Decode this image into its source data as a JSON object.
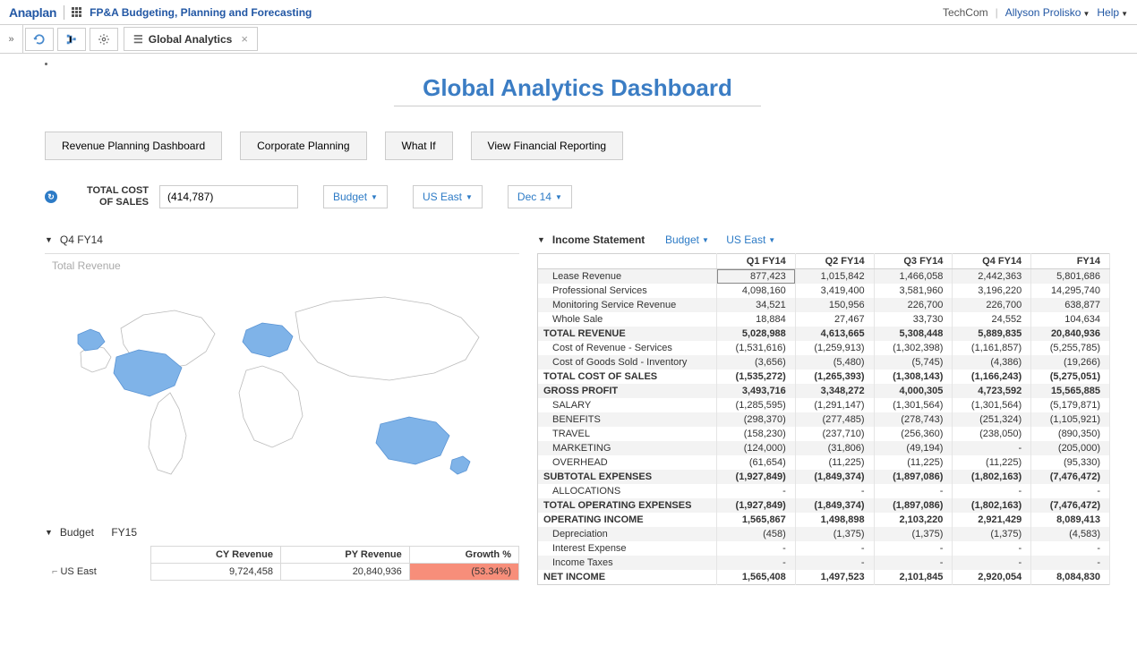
{
  "header": {
    "logo": "Anaplan",
    "breadcrumb": "FP&A Budgeting, Planning and Forecasting",
    "org": "TechCom",
    "user": "Allyson Prolisko",
    "help": "Help"
  },
  "tab": {
    "label": "Global Analytics"
  },
  "page_title": "Global Analytics Dashboard",
  "nav_buttons": [
    "Revenue Planning Dashboard",
    "Corporate Planning",
    "What If",
    "View Financial Reporting"
  ],
  "metric": {
    "label_line1": "TOTAL COST",
    "label_line2": "OF SALES",
    "value": "(414,787)"
  },
  "filters": {
    "version": "Budget",
    "region": "US East",
    "period": "Dec 14"
  },
  "map_panel": {
    "period": "Q4 FY14",
    "subtitle": "Total Revenue"
  },
  "budget_panel": {
    "label": "Budget",
    "year": "FY15",
    "columns": [
      "CY Revenue",
      "PY Revenue",
      "Growth %"
    ],
    "row": {
      "name": "US East",
      "cy": "9,724,458",
      "py": "20,840,936",
      "growth": "(53.34%)"
    }
  },
  "income_panel": {
    "title": "Income Statement",
    "version": "Budget",
    "region": "US East"
  },
  "income_table": {
    "columns": [
      "Q1 FY14",
      "Q2 FY14",
      "Q3 FY14",
      "Q4 FY14",
      "FY14"
    ],
    "rows": [
      {
        "label": "Lease Revenue",
        "values": [
          "877,423",
          "1,015,842",
          "1,466,058",
          "2,442,363",
          "5,801,686"
        ],
        "indent": true,
        "shade": true,
        "selected": 0
      },
      {
        "label": "Professional Services",
        "values": [
          "4,098,160",
          "3,419,400",
          "3,581,960",
          "3,196,220",
          "14,295,740"
        ],
        "indent": true
      },
      {
        "label": "Monitoring Service Revenue",
        "values": [
          "34,521",
          "150,956",
          "226,700",
          "226,700",
          "638,877"
        ],
        "indent": true,
        "shade": true
      },
      {
        "label": "Whole Sale",
        "values": [
          "18,884",
          "27,467",
          "33,730",
          "24,552",
          "104,634"
        ],
        "indent": true
      },
      {
        "label": "TOTAL REVENUE",
        "values": [
          "5,028,988",
          "4,613,665",
          "5,308,448",
          "5,889,835",
          "20,840,936"
        ],
        "bold": true,
        "shade": true
      },
      {
        "label": "Cost of Revenue - Services",
        "values": [
          "(1,531,616)",
          "(1,259,913)",
          "(1,302,398)",
          "(1,161,857)",
          "(5,255,785)"
        ],
        "indent": true
      },
      {
        "label": "Cost of Goods Sold - Inventory",
        "values": [
          "(3,656)",
          "(5,480)",
          "(5,745)",
          "(4,386)",
          "(19,266)"
        ],
        "indent": true,
        "shade": true
      },
      {
        "label": "TOTAL COST OF SALES",
        "values": [
          "(1,535,272)",
          "(1,265,393)",
          "(1,308,143)",
          "(1,166,243)",
          "(5,275,051)"
        ],
        "bold": true
      },
      {
        "label": "GROSS PROFIT",
        "values": [
          "3,493,716",
          "3,348,272",
          "4,000,305",
          "4,723,592",
          "15,565,885"
        ],
        "bold": true,
        "shade": true
      },
      {
        "label": "SALARY",
        "values": [
          "(1,285,595)",
          "(1,291,147)",
          "(1,301,564)",
          "(1,301,564)",
          "(5,179,871)"
        ],
        "indent": true
      },
      {
        "label": "BENEFITS",
        "values": [
          "(298,370)",
          "(277,485)",
          "(278,743)",
          "(251,324)",
          "(1,105,921)"
        ],
        "indent": true,
        "shade": true
      },
      {
        "label": "TRAVEL",
        "values": [
          "(158,230)",
          "(237,710)",
          "(256,360)",
          "(238,050)",
          "(890,350)"
        ],
        "indent": true
      },
      {
        "label": "MARKETING",
        "values": [
          "(124,000)",
          "(31,806)",
          "(49,194)",
          "-",
          "(205,000)"
        ],
        "indent": true,
        "shade": true
      },
      {
        "label": "OVERHEAD",
        "values": [
          "(61,654)",
          "(11,225)",
          "(11,225)",
          "(11,225)",
          "(95,330)"
        ],
        "indent": true
      },
      {
        "label": "SUBTOTAL EXPENSES",
        "values": [
          "(1,927,849)",
          "(1,849,374)",
          "(1,897,086)",
          "(1,802,163)",
          "(7,476,472)"
        ],
        "bold": true,
        "shade": true
      },
      {
        "label": "ALLOCATIONS",
        "values": [
          "-",
          "-",
          "-",
          "-",
          "-"
        ],
        "indent": true
      },
      {
        "label": "TOTAL OPERATING EXPENSES",
        "values": [
          "(1,927,849)",
          "(1,849,374)",
          "(1,897,086)",
          "(1,802,163)",
          "(7,476,472)"
        ],
        "bold": true,
        "shade": true
      },
      {
        "label": "OPERATING INCOME",
        "values": [
          "1,565,867",
          "1,498,898",
          "2,103,220",
          "2,921,429",
          "8,089,413"
        ],
        "bold": true
      },
      {
        "label": "Depreciation",
        "values": [
          "(458)",
          "(1,375)",
          "(1,375)",
          "(1,375)",
          "(4,583)"
        ],
        "indent": true,
        "shade": true
      },
      {
        "label": "Interest Expense",
        "values": [
          "-",
          "-",
          "-",
          "-",
          "-"
        ],
        "indent": true
      },
      {
        "label": "Income Taxes",
        "values": [
          "-",
          "-",
          "-",
          "-",
          "-"
        ],
        "indent": true,
        "shade": true
      },
      {
        "label": "NET INCOME",
        "values": [
          "1,565,408",
          "1,497,523",
          "2,101,845",
          "2,920,054",
          "8,084,830"
        ],
        "bold": true
      }
    ]
  }
}
